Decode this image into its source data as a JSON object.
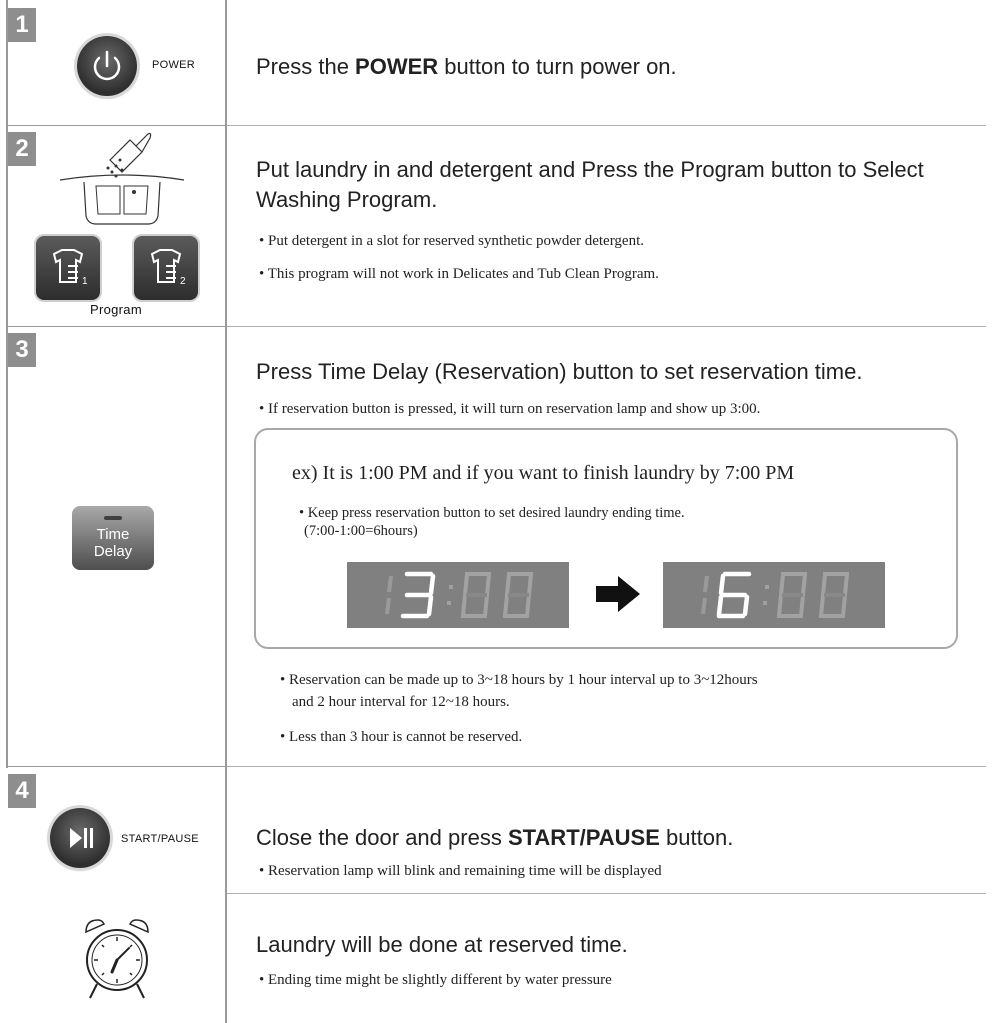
{
  "steps": [
    {
      "number": "1",
      "button_label": "POWER",
      "title_pre": "Press the ",
      "title_bold": "POWER",
      "title_post": " button to turn power on."
    },
    {
      "number": "2",
      "button_label": "Program",
      "title": "Put laundry in and detergent and Press the Program button to Select Washing Program.",
      "bullets": [
        "• Put detergent in a slot for reserved synthetic powder detergent.",
        "• This program will not work in Delicates and Tub Clean Program."
      ]
    },
    {
      "number": "3",
      "button_label_line1": "Time",
      "button_label_line2": "Delay",
      "title": "Press Time Delay (Reservation) button to set reservation time.",
      "bullets": [
        "• If reservation button is pressed, it will turn on reservation lamp and show up  3:00."
      ],
      "example": {
        "heading": "ex) It is 1:00 PM and if you want to finish laundry by  7:00 PM",
        "bullet": "• Keep press reservation button to set desired laundry ending time.",
        "calc": "(7:00-1:00=6hours)",
        "display_from": "3:00",
        "display_to": "6:00"
      },
      "notes": [
        "• Reservation can be made up to 3~18 hours by 1 hour interval up to 3~12hours",
        "and 2 hour interval for 12~18 hours.",
        "• Less than 3 hour is cannot be reserved."
      ]
    },
    {
      "number": "4",
      "button_label": "START/PAUSE",
      "title_pre": "Close the door and press ",
      "title_bold": "START/PAUSE",
      "title_post": " button.",
      "bullets": [
        "• Reservation lamp will blink and remaining time will be displayed"
      ]
    },
    {
      "title": "Laundry will be done at reserved time.",
      "bullets": [
        "• Ending time might be slightly different by water pressure"
      ]
    }
  ],
  "colors": {
    "step_badge": "#8e8e8e",
    "display_bg": "#808080",
    "segment_on": "#ffffff"
  },
  "icons": [
    "power-icon",
    "detergent-scoop-icon",
    "program-shirt-icon",
    "play-pause-icon",
    "arrow-right-icon",
    "alarm-clock-icon"
  ]
}
